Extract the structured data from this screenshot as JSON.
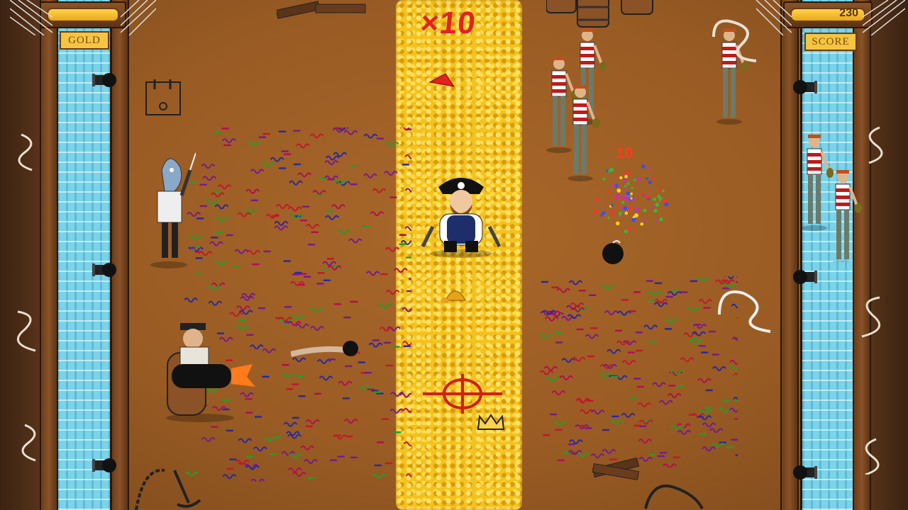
{
  "hud": {
    "gold_label": "GOLD",
    "gold_level": 1.0,
    "score_label": "SCORE",
    "score_value": "230"
  },
  "game": {
    "multiplier": "×10",
    "floating_points": "10"
  },
  "colors": {
    "gold": "#f4c21e",
    "deck": "#9a5c24",
    "water": "#7ad3e8",
    "accent_red": "#e02222"
  },
  "icons": [
    "power-switch-icon",
    "crosshair-icon",
    "crown-icon",
    "bomb-icon",
    "anchor-icon",
    "rope-coil-icon",
    "cannonball-icon"
  ]
}
